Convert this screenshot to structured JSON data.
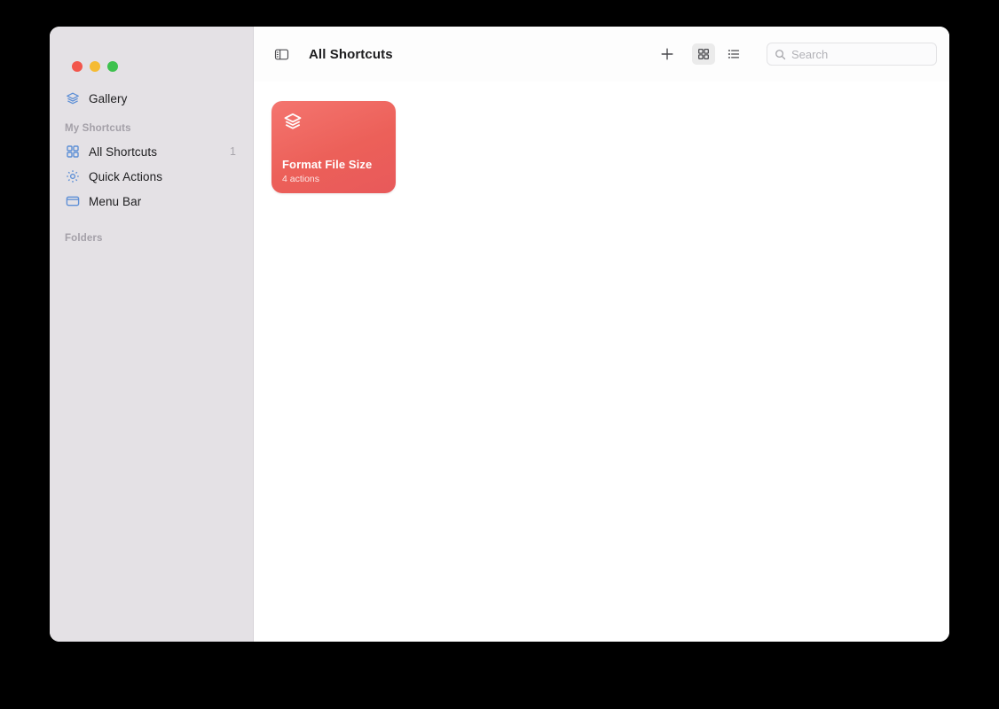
{
  "window": {
    "traffic_lights": {
      "close_color": "#f2564c",
      "minimize_color": "#f5bb32",
      "maximize_color": "#3ec14e"
    }
  },
  "sidebar": {
    "top_items": [
      {
        "label": "Gallery",
        "icon": "layers-icon",
        "count": ""
      }
    ],
    "sections": [
      {
        "header": "My Shortcuts",
        "items": [
          {
            "label": "All Shortcuts",
            "icon": "grid-icon",
            "count": "1"
          },
          {
            "label": "Quick Actions",
            "icon": "gear-icon",
            "count": ""
          },
          {
            "label": "Menu Bar",
            "icon": "menubar-icon",
            "count": ""
          }
        ]
      },
      {
        "header": "Folders",
        "items": []
      }
    ],
    "accent_color": "#5d8fd6",
    "background_color": "#e4e1e5"
  },
  "toolbar": {
    "sidebar_toggle_icon": "sidebar-toggle-icon",
    "title": "All Shortcuts",
    "add_label": "+",
    "grid_view_icon": "grid-view-icon",
    "list_view_icon": "list-view-icon",
    "active_view": "grid",
    "search": {
      "placeholder": "Search",
      "value": "",
      "icon": "search-icon"
    }
  },
  "content": {
    "shortcuts": [
      {
        "title": "Format File Size",
        "subtitle": "4 actions",
        "icon": "layers-icon",
        "color": "#ec6059"
      }
    ]
  }
}
